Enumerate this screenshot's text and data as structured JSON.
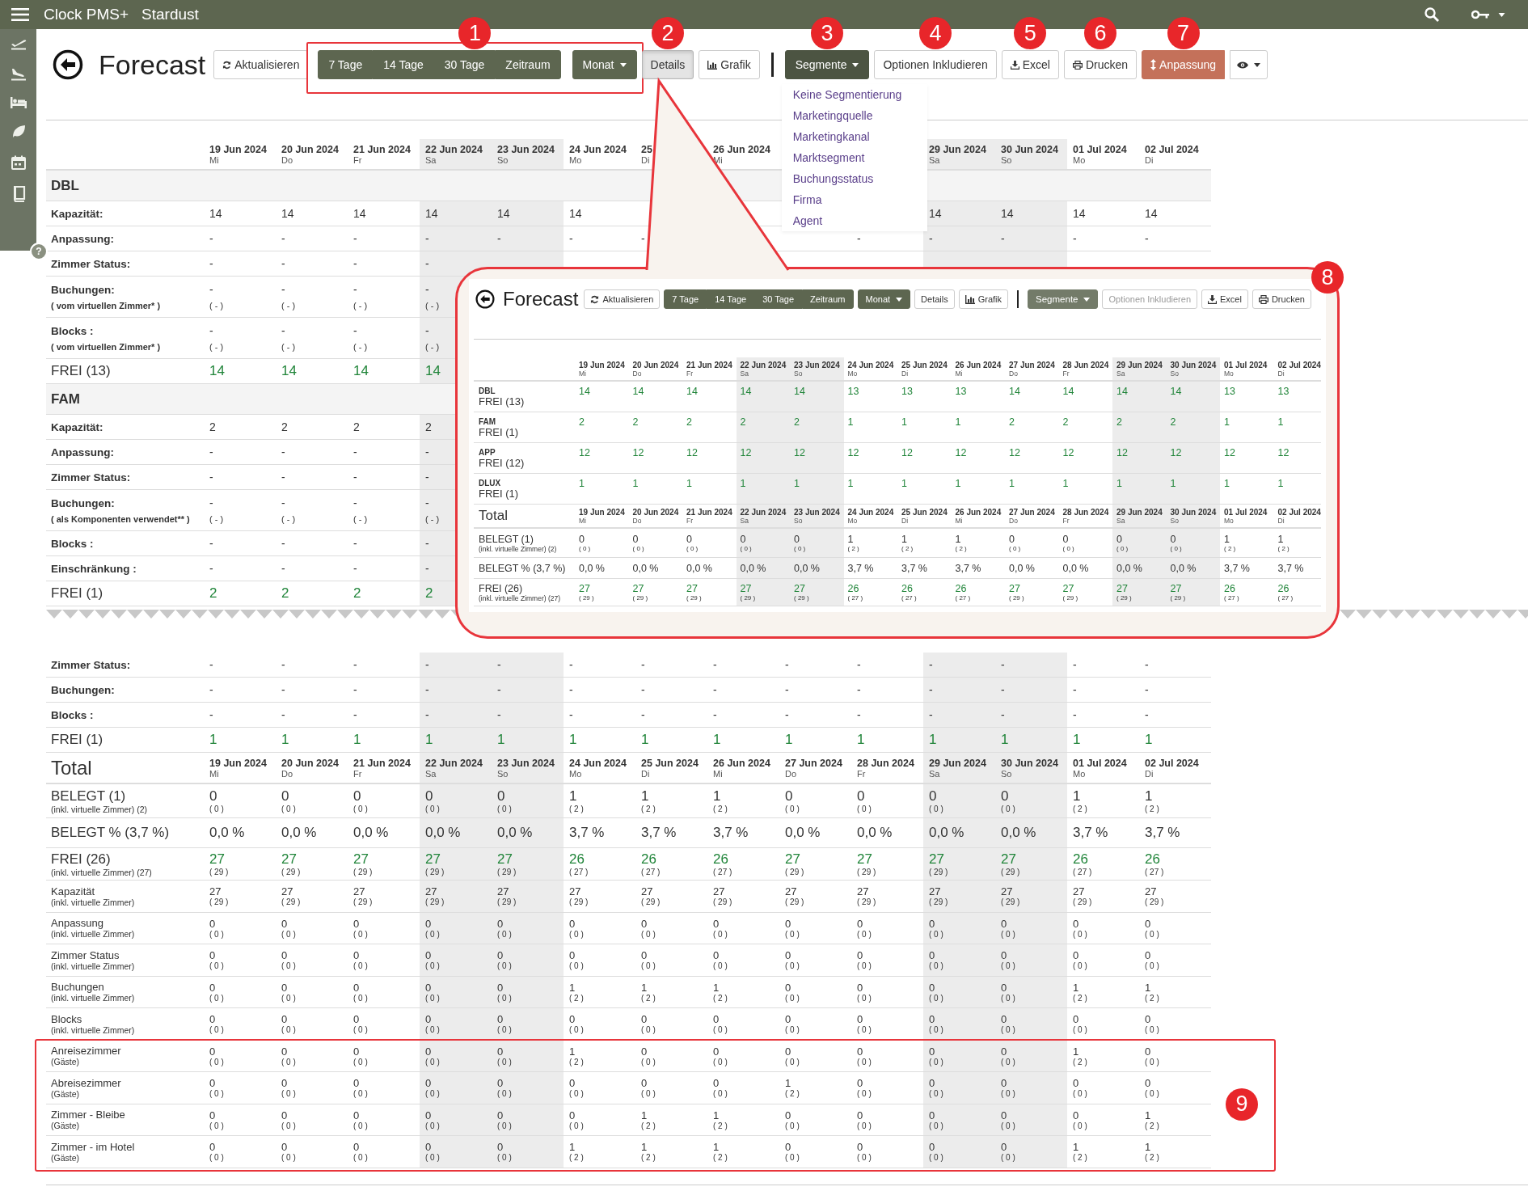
{
  "top_bar": {
    "app": "Clock PMS+",
    "property": "Stardust"
  },
  "sidebar": {
    "help": "?"
  },
  "toolbar": {
    "title": "Forecast",
    "items": [
      {
        "kind": "refresh",
        "label": "Aktualisieren"
      },
      {
        "kind": "annotated",
        "marker": "1",
        "items": [
          {
            "kind": "range",
            "options": [
              {
                "label": "7 Tage"
              },
              {
                "label": "14 Tage"
              },
              {
                "label": "30 Tage"
              },
              {
                "label": "Zeitraum"
              }
            ]
          },
          {
            "kind": "menu",
            "label": "Monat",
            "open": false,
            "disabled": false
          }
        ]
      },
      {
        "kind": "plain",
        "label": "Details",
        "pressed": true,
        "disabled": false,
        "marker": "2"
      },
      {
        "kind": "chart",
        "label": "Grafik"
      },
      {
        "kind": "separator"
      },
      {
        "kind": "menu",
        "label": "Segmente",
        "open": true,
        "disabled": false,
        "marker": "3",
        "menu_items": [
          "Keine Segmentierung",
          "Marketingquelle",
          "Marketingkanal",
          "Marktsegment",
          "Buchungsstatus",
          "Firma",
          "Agent"
        ]
      },
      {
        "kind": "plain",
        "label": "Optionen Inkludieren",
        "pressed": false,
        "disabled": false,
        "marker": "4"
      },
      {
        "kind": "download",
        "label": "Excel",
        "marker": "5"
      },
      {
        "kind": "print",
        "label": "Drucken",
        "marker": "6"
      },
      {
        "kind": "adjust",
        "label": "Anpassung",
        "marker": "7"
      },
      {
        "kind": "view"
      }
    ]
  },
  "upper_table": {
    "rows": [
      {
        "kind": "dates",
        "columns": [
          {
            "date": "19 Jun 2024",
            "weekday": "Mi",
            "weekend": false
          },
          {
            "date": "20 Jun 2024",
            "weekday": "Do",
            "weekend": false
          },
          {
            "date": "21 Jun 2024",
            "weekday": "Fr",
            "weekend": false
          },
          {
            "date": "22 Jun 2024",
            "weekday": "Sa",
            "weekend": true
          },
          {
            "date": "23 Jun 2024",
            "weekday": "So",
            "weekend": true
          },
          {
            "date": "24 Jun 2024",
            "weekday": "Mo",
            "weekend": false
          },
          {
            "date": "25",
            "weekday": "Di",
            "weekend": false
          },
          {
            "date": "26 Jun 2024",
            "weekday": "Mi",
            "weekend": false
          },
          null,
          null,
          {
            "date": "29 Jun 2024",
            "weekday": "Sa",
            "weekend": true
          },
          {
            "date": "30 Jun 2024",
            "weekday": "So",
            "weekend": true
          },
          {
            "date": "01 Jul 2024",
            "weekday": "Mo",
            "weekend": false
          },
          {
            "date": "02 Jul 2024",
            "weekday": "Di",
            "weekend": false
          }
        ]
      },
      {
        "kind": "section",
        "label": "DBL"
      },
      {
        "kind": "field",
        "label": "Kapazität:",
        "cells": [
          "14",
          "14",
          "14",
          "14",
          "14",
          "14",
          null,
          null,
          null,
          null,
          "14",
          "14",
          "14",
          "14"
        ]
      },
      {
        "kind": "field",
        "label": "Anpassung:",
        "cells": [
          "-",
          "-",
          "-",
          "-",
          "-",
          "-",
          "-",
          null,
          null,
          "-",
          "-",
          "-",
          "-",
          "-"
        ]
      },
      {
        "kind": "field",
        "label": "Zimmer Status:",
        "cells": [
          "-",
          "-",
          "-",
          "-",
          null,
          null,
          null,
          null,
          null,
          null,
          null,
          null,
          null,
          null
        ]
      },
      {
        "kind": "field",
        "label": "Buchungen:",
        "sublabel": "( vom virtuellen Zimmer* )",
        "cells": [
          [
            "-",
            "( - )"
          ],
          [
            "-",
            "( - )"
          ],
          [
            "-",
            "( - )"
          ],
          [
            "-",
            "( - )"
          ],
          null,
          null,
          null,
          null,
          null,
          null,
          null,
          null,
          null,
          null
        ]
      },
      {
        "kind": "field",
        "label": "Blocks :",
        "sublabel": "( vom virtuellen Zimmer* )",
        "cells": [
          [
            "-",
            "( - )"
          ],
          [
            "-",
            "( - )"
          ],
          [
            "-",
            "( - )"
          ],
          [
            "-",
            "( - )"
          ],
          null,
          null,
          null,
          null,
          null,
          null,
          null,
          null,
          null,
          null
        ]
      },
      {
        "kind": "free",
        "label": "FREI (13)",
        "cells": [
          "14",
          "14",
          "14",
          "14",
          null,
          null,
          null,
          null,
          null,
          null,
          null,
          null,
          null,
          null
        ]
      },
      {
        "kind": "section",
        "label": "FAM"
      },
      {
        "kind": "field",
        "label": "Kapazität:",
        "cells": [
          "2",
          "2",
          "2",
          "2",
          null,
          null,
          null,
          null,
          null,
          null,
          null,
          null,
          null,
          null
        ]
      },
      {
        "kind": "field",
        "label": "Anpassung:",
        "cells": [
          "-",
          "-",
          "-",
          "-",
          null,
          null,
          null,
          null,
          null,
          null,
          null,
          null,
          null,
          null
        ]
      },
      {
        "kind": "field",
        "label": "Zimmer Status:",
        "cells": [
          "-",
          "-",
          "-",
          "-",
          null,
          null,
          null,
          null,
          null,
          null,
          null,
          null,
          null,
          null
        ]
      },
      {
        "kind": "field",
        "label": "Buchungen:",
        "sublabel": "( als Komponenten verwendet** )",
        "cells": [
          [
            "-",
            "( - )"
          ],
          [
            "-",
            "( - )"
          ],
          [
            "-",
            "( - )"
          ],
          [
            "-",
            "( - )"
          ],
          null,
          null,
          null,
          null,
          null,
          null,
          null,
          null,
          null,
          null
        ]
      },
      {
        "kind": "field",
        "label": "Blocks :",
        "cells": [
          "-",
          "-",
          "-",
          "-",
          null,
          null,
          null,
          null,
          null,
          null,
          null,
          null,
          null,
          null
        ]
      },
      {
        "kind": "field",
        "label": "Einschränkung :",
        "cells": [
          "-",
          "-",
          "-",
          "-",
          null,
          null,
          null,
          null,
          null,
          null,
          null,
          null,
          null,
          null
        ]
      },
      {
        "kind": "free",
        "label": "FREI (1)",
        "cells": [
          "2",
          "2",
          "2",
          "2",
          null,
          null,
          null,
          null,
          null,
          null,
          null,
          null,
          null,
          null
        ]
      }
    ]
  },
  "lower_table": {
    "rows": [
      {
        "kind": "field",
        "label": "Zimmer Status:",
        "cells": [
          "-",
          "-",
          "-",
          "-",
          "-",
          "-",
          "-",
          "-",
          "-",
          "-",
          "-",
          "-",
          "-",
          "-"
        ]
      },
      {
        "kind": "field",
        "label": "Buchungen:",
        "cells": [
          "-",
          "-",
          "-",
          "-",
          "-",
          "-",
          "-",
          "-",
          "-",
          "-",
          "-",
          "-",
          "-",
          "-"
        ]
      },
      {
        "kind": "field",
        "label": "Blocks :",
        "cells": [
          "-",
          "-",
          "-",
          "-",
          "-",
          "-",
          "-",
          "-",
          "-",
          "-",
          "-",
          "-",
          "-",
          "-"
        ]
      },
      {
        "kind": "free",
        "label": "FREI (1)",
        "cells": [
          "1",
          "1",
          "1",
          "1",
          "1",
          "1",
          "1",
          "1",
          "1",
          "1",
          "1",
          "1",
          "1",
          "1"
        ]
      },
      {
        "kind": "dates",
        "label": "Total",
        "columns": [
          {
            "date": "19 Jun 2024",
            "weekday": "Mi",
            "weekend": false
          },
          {
            "date": "20 Jun 2024",
            "weekday": "Do",
            "weekend": false
          },
          {
            "date": "21 Jun 2024",
            "weekday": "Fr",
            "weekend": false
          },
          {
            "date": "22 Jun 2024",
            "weekday": "Sa",
            "weekend": true
          },
          {
            "date": "23 Jun 2024",
            "weekday": "So",
            "weekend": true
          },
          {
            "date": "24 Jun 2024",
            "weekday": "Mo",
            "weekend": false
          },
          {
            "date": "25 Jun 2024",
            "weekday": "Di",
            "weekend": false
          },
          {
            "date": "26 Jun 2024",
            "weekday": "Mi",
            "weekend": false
          },
          {
            "date": "27 Jun 2024",
            "weekday": "Do",
            "weekend": false
          },
          {
            "date": "28 Jun 2024",
            "weekday": "Fr",
            "weekend": false
          },
          {
            "date": "29 Jun 2024",
            "weekday": "Sa",
            "weekend": true
          },
          {
            "date": "30 Jun 2024",
            "weekday": "So",
            "weekend": true
          },
          {
            "date": "01 Jul 2024",
            "weekday": "Mo",
            "weekend": false
          },
          {
            "date": "02 Jul 2024",
            "weekday": "Di",
            "weekend": false
          }
        ]
      },
      {
        "kind": "stat",
        "label": "BELEGT (1)",
        "sublabel": "(inkl. virtuelle Zimmer) (2)",
        "cells": [
          [
            "0",
            "( 0 )"
          ],
          [
            "0",
            "( 0 )"
          ],
          [
            "0",
            "( 0 )"
          ],
          [
            "0",
            "( 0 )"
          ],
          [
            "0",
            "( 0 )"
          ],
          [
            "1",
            "( 2 )"
          ],
          [
            "1",
            "( 2 )"
          ],
          [
            "1",
            "( 2 )"
          ],
          [
            "0",
            "( 0 )"
          ],
          [
            "0",
            "( 0 )"
          ],
          [
            "0",
            "( 0 )"
          ],
          [
            "0",
            "( 0 )"
          ],
          [
            "1",
            "( 2 )"
          ],
          [
            "1",
            "( 2 )"
          ]
        ]
      },
      {
        "kind": "percent",
        "label": "BELEGT % (3,7 %)",
        "cells": [
          "0,0 %",
          "0,0 %",
          "0,0 %",
          "0,0 %",
          "0,0 %",
          "3,7 %",
          "3,7 %",
          "3,7 %",
          "0,0 %",
          "0,0 %",
          "0,0 %",
          "0,0 %",
          "3,7 %",
          "3,7 %"
        ]
      },
      {
        "kind": "stat_free",
        "label": "FREI (26)",
        "sublabel": "(inkl. virtuelle Zimmer) (27)",
        "cells": [
          [
            "27",
            "( 29 )"
          ],
          [
            "27",
            "( 29 )"
          ],
          [
            "27",
            "( 29 )"
          ],
          [
            "27",
            "( 29 )"
          ],
          [
            "27",
            "( 29 )"
          ],
          [
            "26",
            "( 27 )"
          ],
          [
            "26",
            "( 27 )"
          ],
          [
            "26",
            "( 27 )"
          ],
          [
            "27",
            "( 29 )"
          ],
          [
            "27",
            "( 29 )"
          ],
          [
            "27",
            "( 29 )"
          ],
          [
            "27",
            "( 29 )"
          ],
          [
            "26",
            "( 27 )"
          ],
          [
            "26",
            "( 27 )"
          ]
        ]
      },
      {
        "kind": "detail",
        "label": "Kapazität",
        "sublabel": "(inkl. virtuelle Zimmer)",
        "cells": [
          [
            "27",
            "( 29 )"
          ],
          [
            "27",
            "( 29 )"
          ],
          [
            "27",
            "( 29 )"
          ],
          [
            "27",
            "( 29 )"
          ],
          [
            "27",
            "( 29 )"
          ],
          [
            "27",
            "( 29 )"
          ],
          [
            "27",
            "( 29 )"
          ],
          [
            "27",
            "( 29 )"
          ],
          [
            "27",
            "( 29 )"
          ],
          [
            "27",
            "( 29 )"
          ],
          [
            "27",
            "( 29 )"
          ],
          [
            "27",
            "( 29 )"
          ],
          [
            "27",
            "( 29 )"
          ],
          [
            "27",
            "( 29 )"
          ]
        ]
      },
      {
        "kind": "detail",
        "label": "Anpassung",
        "sublabel": "(inkl. virtuelle Zimmer)",
        "cells": [
          [
            "0",
            "( 0 )"
          ],
          [
            "0",
            "( 0 )"
          ],
          [
            "0",
            "( 0 )"
          ],
          [
            "0",
            "( 0 )"
          ],
          [
            "0",
            "( 0 )"
          ],
          [
            "0",
            "( 0 )"
          ],
          [
            "0",
            "( 0 )"
          ],
          [
            "0",
            "( 0 )"
          ],
          [
            "0",
            "( 0 )"
          ],
          [
            "0",
            "( 0 )"
          ],
          [
            "0",
            "( 0 )"
          ],
          [
            "0",
            "( 0 )"
          ],
          [
            "0",
            "( 0 )"
          ],
          [
            "0",
            "( 0 )"
          ]
        ]
      },
      {
        "kind": "detail",
        "label": "Zimmer Status",
        "sublabel": "(inkl. virtuelle Zimmer)",
        "cells": [
          [
            "0",
            "( 0 )"
          ],
          [
            "0",
            "( 0 )"
          ],
          [
            "0",
            "( 0 )"
          ],
          [
            "0",
            "( 0 )"
          ],
          [
            "0",
            "( 0 )"
          ],
          [
            "0",
            "( 0 )"
          ],
          [
            "0",
            "( 0 )"
          ],
          [
            "0",
            "( 0 )"
          ],
          [
            "0",
            "( 0 )"
          ],
          [
            "0",
            "( 0 )"
          ],
          [
            "0",
            "( 0 )"
          ],
          [
            "0",
            "( 0 )"
          ],
          [
            "0",
            "( 0 )"
          ],
          [
            "0",
            "( 0 )"
          ]
        ]
      },
      {
        "kind": "detail",
        "label": "Buchungen",
        "sublabel": "(inkl. virtuelle Zimmer)",
        "cells": [
          [
            "0",
            "( 0 )"
          ],
          [
            "0",
            "( 0 )"
          ],
          [
            "0",
            "( 0 )"
          ],
          [
            "0",
            "( 0 )"
          ],
          [
            "0",
            "( 0 )"
          ],
          [
            "1",
            "( 2 )"
          ],
          [
            "1",
            "( 2 )"
          ],
          [
            "1",
            "( 2 )"
          ],
          [
            "0",
            "( 0 )"
          ],
          [
            "0",
            "( 0 )"
          ],
          [
            "0",
            "( 0 )"
          ],
          [
            "0",
            "( 0 )"
          ],
          [
            "1",
            "( 2 )"
          ],
          [
            "1",
            "( 2 )"
          ]
        ]
      },
      {
        "kind": "detail",
        "label": "Blocks",
        "sublabel": "(inkl. virtuelle Zimmer)",
        "cells": [
          [
            "0",
            "( 0 )"
          ],
          [
            "0",
            "( 0 )"
          ],
          [
            "0",
            "( 0 )"
          ],
          [
            "0",
            "( 0 )"
          ],
          [
            "0",
            "( 0 )"
          ],
          [
            "0",
            "( 0 )"
          ],
          [
            "0",
            "( 0 )"
          ],
          [
            "0",
            "( 0 )"
          ],
          [
            "0",
            "( 0 )"
          ],
          [
            "0",
            "( 0 )"
          ],
          [
            "0",
            "( 0 )"
          ],
          [
            "0",
            "( 0 )"
          ],
          [
            "0",
            "( 0 )"
          ],
          [
            "0",
            "( 0 )"
          ]
        ]
      },
      {
        "kind": "group",
        "marker": "9",
        "rows": [
          {
            "kind": "detail",
            "label": "Anreisezimmer",
            "sublabel": "(Gäste)",
            "cells": [
              [
                "0",
                "( 0 )"
              ],
              [
                "0",
                "( 0 )"
              ],
              [
                "0",
                "( 0 )"
              ],
              [
                "0",
                "( 0 )"
              ],
              [
                "0",
                "( 0 )"
              ],
              [
                "1",
                "( 2 )"
              ],
              [
                "0",
                "( 0 )"
              ],
              [
                "0",
                "( 0 )"
              ],
              [
                "0",
                "( 0 )"
              ],
              [
                "0",
                "( 0 )"
              ],
              [
                "0",
                "( 0 )"
              ],
              [
                "0",
                "( 0 )"
              ],
              [
                "1",
                "( 2 )"
              ],
              [
                "0",
                "( 0 )"
              ]
            ]
          },
          {
            "kind": "detail",
            "label": "Abreisezimmer",
            "sublabel": "(Gäste)",
            "cells": [
              [
                "0",
                "( 0 )"
              ],
              [
                "0",
                "( 0 )"
              ],
              [
                "0",
                "( 0 )"
              ],
              [
                "0",
                "( 0 )"
              ],
              [
                "0",
                "( 0 )"
              ],
              [
                "0",
                "( 0 )"
              ],
              [
                "0",
                "( 0 )"
              ],
              [
                "0",
                "( 0 )"
              ],
              [
                "1",
                "( 2 )"
              ],
              [
                "0",
                "( 0 )"
              ],
              [
                "0",
                "( 0 )"
              ],
              [
                "0",
                "( 0 )"
              ],
              [
                "0",
                "( 0 )"
              ],
              [
                "0",
                "( 0 )"
              ]
            ]
          },
          {
            "kind": "detail",
            "label": "Zimmer - Bleibe",
            "sublabel": "(Gäste)",
            "cells": [
              [
                "0",
                "( 0 )"
              ],
              [
                "0",
                "( 0 )"
              ],
              [
                "0",
                "( 0 )"
              ],
              [
                "0",
                "( 0 )"
              ],
              [
                "0",
                "( 0 )"
              ],
              [
                "0",
                "( 0 )"
              ],
              [
                "1",
                "( 2 )"
              ],
              [
                "1",
                "( 2 )"
              ],
              [
                "0",
                "( 0 )"
              ],
              [
                "0",
                "( 0 )"
              ],
              [
                "0",
                "( 0 )"
              ],
              [
                "0",
                "( 0 )"
              ],
              [
                "0",
                "( 0 )"
              ],
              [
                "1",
                "( 2 )"
              ]
            ]
          },
          {
            "kind": "detail",
            "label": "Zimmer - im Hotel",
            "sublabel": "(Gäste)",
            "cells": [
              [
                "0",
                "( 0 )"
              ],
              [
                "0",
                "( 0 )"
              ],
              [
                "0",
                "( 0 )"
              ],
              [
                "0",
                "( 0 )"
              ],
              [
                "0",
                "( 0 )"
              ],
              [
                "1",
                "( 2 )"
              ],
              [
                "1",
                "( 2 )"
              ],
              [
                "1",
                "( 2 )"
              ],
              [
                "0",
                "( 0 )"
              ],
              [
                "0",
                "( 0 )"
              ],
              [
                "0",
                "( 0 )"
              ],
              [
                "0",
                "( 0 )"
              ],
              [
                "1",
                "( 2 )"
              ],
              [
                "1",
                "( 2 )"
              ]
            ]
          }
        ]
      }
    ]
  },
  "inset": {
    "marker": "8",
    "toolbar": {
      "title": "Forecast",
      "items": [
        {
          "kind": "refresh",
          "label": "Aktualisieren"
        },
        {
          "kind": "range",
          "options": [
            {
              "label": "7 Tage"
            },
            {
              "label": "14 Tage"
            },
            {
              "label": "30 Tage"
            },
            {
              "label": "Zeitraum"
            }
          ]
        },
        {
          "kind": "menu",
          "label": "Monat",
          "open": false,
          "disabled": false
        },
        {
          "kind": "plain",
          "label": "Details",
          "pressed": false,
          "disabled": false
        },
        {
          "kind": "chart",
          "label": "Grafik"
        },
        {
          "kind": "separator"
        },
        {
          "kind": "menu",
          "label": "Segmente",
          "open": false,
          "disabled": true
        },
        {
          "kind": "plain",
          "label": "Optionen Inkludieren",
          "pressed": false,
          "disabled": true
        },
        {
          "kind": "download",
          "label": "Excel"
        },
        {
          "kind": "print",
          "label": "Drucken"
        }
      ]
    },
    "table": {
      "rows": [
        {
          "kind": "dates",
          "columns": [
            {
              "date": "19 Jun 2024",
              "weekday": "Mi",
              "weekend": false
            },
            {
              "date": "20 Jun 2024",
              "weekday": "Do",
              "weekend": false
            },
            {
              "date": "21 Jun 2024",
              "weekday": "Fr",
              "weekend": false
            },
            {
              "date": "22 Jun 2024",
              "weekday": "Sa",
              "weekend": true
            },
            {
              "date": "23 Jun 2024",
              "weekday": "So",
              "weekend": true
            },
            {
              "date": "24 Jun 2024",
              "weekday": "Mo",
              "weekend": false
            },
            {
              "date": "25 Jun 2024",
              "weekday": "Di",
              "weekend": false
            },
            {
              "date": "26 Jun 2024",
              "weekday": "Mi",
              "weekend": false
            },
            {
              "date": "27 Jun 2024",
              "weekday": "Do",
              "weekend": false
            },
            {
              "date": "28 Jun 2024",
              "weekday": "Fr",
              "weekend": false
            },
            {
              "date": "29 Jun 2024",
              "weekday": "Sa",
              "weekend": true
            },
            {
              "date": "30 Jun 2024",
              "weekday": "So",
              "weekend": true
            },
            {
              "date": "01 Jul 2024",
              "weekday": "Mo",
              "weekend": false
            },
            {
              "date": "02 Jul 2024",
              "weekday": "Di",
              "weekend": false
            }
          ]
        },
        {
          "kind": "room",
          "code": "DBL",
          "label": "FREI (13)",
          "cells": [
            "14",
            "14",
            "14",
            "14",
            "14",
            "13",
            "13",
            "13",
            "14",
            "14",
            "14",
            "14",
            "13",
            "13"
          ]
        },
        {
          "kind": "room",
          "code": "FAM",
          "label": "FREI (1)",
          "cells": [
            "2",
            "2",
            "2",
            "2",
            "2",
            "1",
            "1",
            "1",
            "2",
            "2",
            "2",
            "2",
            "1",
            "1"
          ]
        },
        {
          "kind": "room",
          "code": "APP",
          "label": "FREI (12)",
          "cells": [
            "12",
            "12",
            "12",
            "12",
            "12",
            "12",
            "12",
            "12",
            "12",
            "12",
            "12",
            "12",
            "12",
            "12"
          ]
        },
        {
          "kind": "room",
          "code": "DLUX",
          "label": "FREI (1)",
          "cells": [
            "1",
            "1",
            "1",
            "1",
            "1",
            "1",
            "1",
            "1",
            "1",
            "1",
            "1",
            "1",
            "1",
            "1"
          ]
        },
        {
          "kind": "dates",
          "label": "Total",
          "columns": [
            {
              "date": "19 Jun 2024",
              "weekday": "Mi",
              "weekend": false
            },
            {
              "date": "20 Jun 2024",
              "weekday": "Do",
              "weekend": false
            },
            {
              "date": "21 Jun 2024",
              "weekday": "Fr",
              "weekend": false
            },
            {
              "date": "22 Jun 2024",
              "weekday": "Sa",
              "weekend": true
            },
            {
              "date": "23 Jun 2024",
              "weekday": "So",
              "weekend": true
            },
            {
              "date": "24 Jun 2024",
              "weekday": "Mo",
              "weekend": false
            },
            {
              "date": "25 Jun 2024",
              "weekday": "Di",
              "weekend": false
            },
            {
              "date": "26 Jun 2024",
              "weekday": "Mi",
              "weekend": false
            },
            {
              "date": "27 Jun 2024",
              "weekday": "Do",
              "weekend": false
            },
            {
              "date": "28 Jun 2024",
              "weekday": "Fr",
              "weekend": false
            },
            {
              "date": "29 Jun 2024",
              "weekday": "Sa",
              "weekend": true
            },
            {
              "date": "30 Jun 2024",
              "weekday": "So",
              "weekend": true
            },
            {
              "date": "01 Jul 2024",
              "weekday": "Mo",
              "weekend": false
            },
            {
              "date": "02 Jul 2024",
              "weekday": "Di",
              "weekend": false
            }
          ]
        },
        {
          "kind": "stat",
          "label": "BELEGT (1)",
          "sublabel": "(inkl. virtuelle Zimmer) (2)",
          "cells": [
            [
              "0",
              "( 0 )"
            ],
            [
              "0",
              "( 0 )"
            ],
            [
              "0",
              "( 0 )"
            ],
            [
              "0",
              "( 0 )"
            ],
            [
              "0",
              "( 0 )"
            ],
            [
              "1",
              "( 2 )"
            ],
            [
              "1",
              "( 2 )"
            ],
            [
              "1",
              "( 2 )"
            ],
            [
              "0",
              "( 0 )"
            ],
            [
              "0",
              "( 0 )"
            ],
            [
              "0",
              "( 0 )"
            ],
            [
              "0",
              "( 0 )"
            ],
            [
              "1",
              "( 2 )"
            ],
            [
              "1",
              "( 2 )"
            ]
          ]
        },
        {
          "kind": "percent",
          "label": "BELEGT % (3,7 %)",
          "cells": [
            "0,0 %",
            "0,0 %",
            "0,0 %",
            "0,0 %",
            "0,0 %",
            "3,7 %",
            "3,7 %",
            "3,7 %",
            "0,0 %",
            "0,0 %",
            "0,0 %",
            "0,0 %",
            "3,7 %",
            "3,7 %"
          ]
        },
        {
          "kind": "stat_free",
          "label": "FREI (26)",
          "sublabel": "(inkl. virtuelle Zimmer) (27)",
          "cells": [
            [
              "27",
              "( 29 )"
            ],
            [
              "27",
              "( 29 )"
            ],
            [
              "27",
              "( 29 )"
            ],
            [
              "27",
              "( 29 )"
            ],
            [
              "27",
              "( 29 )"
            ],
            [
              "26",
              "( 27 )"
            ],
            [
              "26",
              "( 27 )"
            ],
            [
              "26",
              "( 27 )"
            ],
            [
              "27",
              "( 29 )"
            ],
            [
              "27",
              "( 29 )"
            ],
            [
              "27",
              "( 29 )"
            ],
            [
              "27",
              "( 29 )"
            ],
            [
              "26",
              "( 27 )"
            ],
            [
              "26",
              "( 27 )"
            ]
          ]
        }
      ]
    }
  }
}
